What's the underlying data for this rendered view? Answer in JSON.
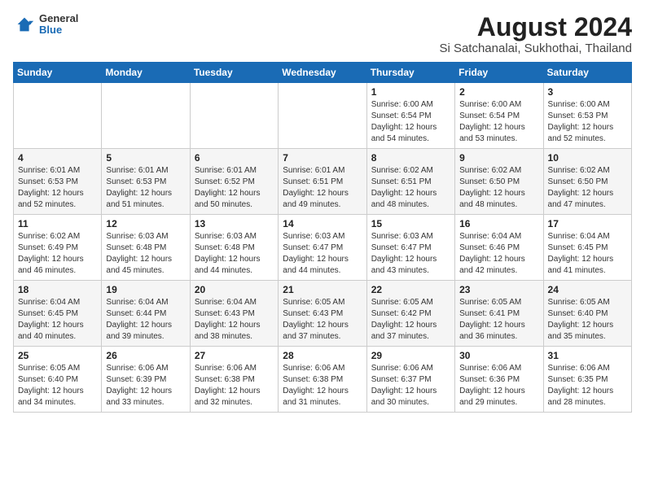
{
  "logo": {
    "general": "General",
    "blue": "Blue"
  },
  "title": {
    "month_year": "August 2024",
    "location": "Si Satchanalai, Sukhothai, Thailand"
  },
  "headers": [
    "Sunday",
    "Monday",
    "Tuesday",
    "Wednesday",
    "Thursday",
    "Friday",
    "Saturday"
  ],
  "weeks": [
    [
      {
        "day": "",
        "info": ""
      },
      {
        "day": "",
        "info": ""
      },
      {
        "day": "",
        "info": ""
      },
      {
        "day": "",
        "info": ""
      },
      {
        "day": "1",
        "info": "Sunrise: 6:00 AM\nSunset: 6:54 PM\nDaylight: 12 hours\nand 54 minutes."
      },
      {
        "day": "2",
        "info": "Sunrise: 6:00 AM\nSunset: 6:54 PM\nDaylight: 12 hours\nand 53 minutes."
      },
      {
        "day": "3",
        "info": "Sunrise: 6:00 AM\nSunset: 6:53 PM\nDaylight: 12 hours\nand 52 minutes."
      }
    ],
    [
      {
        "day": "4",
        "info": "Sunrise: 6:01 AM\nSunset: 6:53 PM\nDaylight: 12 hours\nand 52 minutes."
      },
      {
        "day": "5",
        "info": "Sunrise: 6:01 AM\nSunset: 6:53 PM\nDaylight: 12 hours\nand 51 minutes."
      },
      {
        "day": "6",
        "info": "Sunrise: 6:01 AM\nSunset: 6:52 PM\nDaylight: 12 hours\nand 50 minutes."
      },
      {
        "day": "7",
        "info": "Sunrise: 6:01 AM\nSunset: 6:51 PM\nDaylight: 12 hours\nand 49 minutes."
      },
      {
        "day": "8",
        "info": "Sunrise: 6:02 AM\nSunset: 6:51 PM\nDaylight: 12 hours\nand 48 minutes."
      },
      {
        "day": "9",
        "info": "Sunrise: 6:02 AM\nSunset: 6:50 PM\nDaylight: 12 hours\nand 48 minutes."
      },
      {
        "day": "10",
        "info": "Sunrise: 6:02 AM\nSunset: 6:50 PM\nDaylight: 12 hours\nand 47 minutes."
      }
    ],
    [
      {
        "day": "11",
        "info": "Sunrise: 6:02 AM\nSunset: 6:49 PM\nDaylight: 12 hours\nand 46 minutes."
      },
      {
        "day": "12",
        "info": "Sunrise: 6:03 AM\nSunset: 6:48 PM\nDaylight: 12 hours\nand 45 minutes."
      },
      {
        "day": "13",
        "info": "Sunrise: 6:03 AM\nSunset: 6:48 PM\nDaylight: 12 hours\nand 44 minutes."
      },
      {
        "day": "14",
        "info": "Sunrise: 6:03 AM\nSunset: 6:47 PM\nDaylight: 12 hours\nand 44 minutes."
      },
      {
        "day": "15",
        "info": "Sunrise: 6:03 AM\nSunset: 6:47 PM\nDaylight: 12 hours\nand 43 minutes."
      },
      {
        "day": "16",
        "info": "Sunrise: 6:04 AM\nSunset: 6:46 PM\nDaylight: 12 hours\nand 42 minutes."
      },
      {
        "day": "17",
        "info": "Sunrise: 6:04 AM\nSunset: 6:45 PM\nDaylight: 12 hours\nand 41 minutes."
      }
    ],
    [
      {
        "day": "18",
        "info": "Sunrise: 6:04 AM\nSunset: 6:45 PM\nDaylight: 12 hours\nand 40 minutes."
      },
      {
        "day": "19",
        "info": "Sunrise: 6:04 AM\nSunset: 6:44 PM\nDaylight: 12 hours\nand 39 minutes."
      },
      {
        "day": "20",
        "info": "Sunrise: 6:04 AM\nSunset: 6:43 PM\nDaylight: 12 hours\nand 38 minutes."
      },
      {
        "day": "21",
        "info": "Sunrise: 6:05 AM\nSunset: 6:43 PM\nDaylight: 12 hours\nand 37 minutes."
      },
      {
        "day": "22",
        "info": "Sunrise: 6:05 AM\nSunset: 6:42 PM\nDaylight: 12 hours\nand 37 minutes."
      },
      {
        "day": "23",
        "info": "Sunrise: 6:05 AM\nSunset: 6:41 PM\nDaylight: 12 hours\nand 36 minutes."
      },
      {
        "day": "24",
        "info": "Sunrise: 6:05 AM\nSunset: 6:40 PM\nDaylight: 12 hours\nand 35 minutes."
      }
    ],
    [
      {
        "day": "25",
        "info": "Sunrise: 6:05 AM\nSunset: 6:40 PM\nDaylight: 12 hours\nand 34 minutes."
      },
      {
        "day": "26",
        "info": "Sunrise: 6:06 AM\nSunset: 6:39 PM\nDaylight: 12 hours\nand 33 minutes."
      },
      {
        "day": "27",
        "info": "Sunrise: 6:06 AM\nSunset: 6:38 PM\nDaylight: 12 hours\nand 32 minutes."
      },
      {
        "day": "28",
        "info": "Sunrise: 6:06 AM\nSunset: 6:38 PM\nDaylight: 12 hours\nand 31 minutes."
      },
      {
        "day": "29",
        "info": "Sunrise: 6:06 AM\nSunset: 6:37 PM\nDaylight: 12 hours\nand 30 minutes."
      },
      {
        "day": "30",
        "info": "Sunrise: 6:06 AM\nSunset: 6:36 PM\nDaylight: 12 hours\nand 29 minutes."
      },
      {
        "day": "31",
        "info": "Sunrise: 6:06 AM\nSunset: 6:35 PM\nDaylight: 12 hours\nand 28 minutes."
      }
    ]
  ]
}
